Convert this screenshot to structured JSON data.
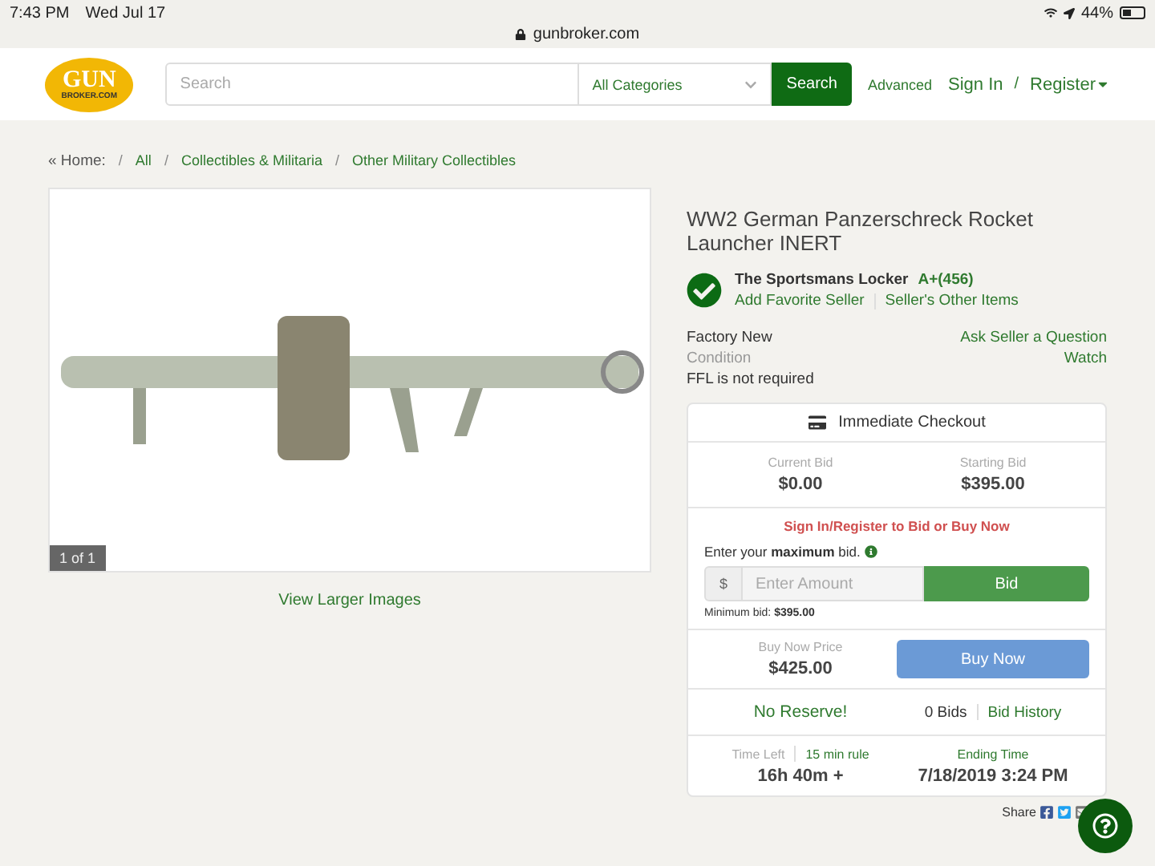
{
  "status_bar": {
    "time": "7:43 PM",
    "date": "Wed Jul 17",
    "battery": "44%"
  },
  "address_bar": {
    "url": "gunbroker.com"
  },
  "header": {
    "logo": {
      "top": "GUN",
      "bottom": "BROKER.COM"
    },
    "search": {
      "placeholder": "Search"
    },
    "category": "All Categories",
    "search_button": "Search",
    "advanced": "Advanced",
    "sign_in": "Sign In",
    "separator": "/",
    "register": "Register"
  },
  "breadcrumb": {
    "lead": "« Home:",
    "separator": "/",
    "items": [
      "All",
      "Collectibles & Militaria",
      "Other Military Collectibles"
    ]
  },
  "gallery": {
    "counter": "1 of 1",
    "link": "View Larger Images"
  },
  "item": {
    "title": "WW2 German Panzerschreck Rocket Launcher INERT",
    "seller": "The Sportsmans Locker",
    "rating": "A+(456)",
    "seller_links": [
      "Add Favorite Seller",
      "Seller's Other Items"
    ],
    "condition": "Factory New",
    "condition_label": "Condition",
    "ffl": "FFL is not required",
    "ask": "Ask Seller a Question",
    "watch": "Watch"
  },
  "checkout": {
    "title": "Immediate Checkout",
    "bids": [
      {
        "label": "Current Bid",
        "value": "$0.00"
      },
      {
        "label": "Starting Bid",
        "value": "$395.00"
      }
    ],
    "notice": "Sign In/Register to Bid or Buy Now",
    "prompt": "Enter your **maximum** bid.",
    "currency": "$",
    "amount": {
      "placeholder": "Enter Amount"
    },
    "bid_button": "Bid",
    "minimum": "Minimum bid: **$395.00**",
    "buy_now": {
      "label": "Buy Now Price",
      "value": "$425.00",
      "button": "Buy Now"
    },
    "reserve": "No Reserve!",
    "bid_count": "0 Bids",
    "history": "Bid History",
    "time_left": {
      "label": "Time Left",
      "rule": "15 min rule",
      "value": "16h 40m +"
    },
    "ending": {
      "label": "Ending Time",
      "value": "7/18/2019 3:24 PM"
    }
  },
  "share": {
    "label": "Share"
  }
}
